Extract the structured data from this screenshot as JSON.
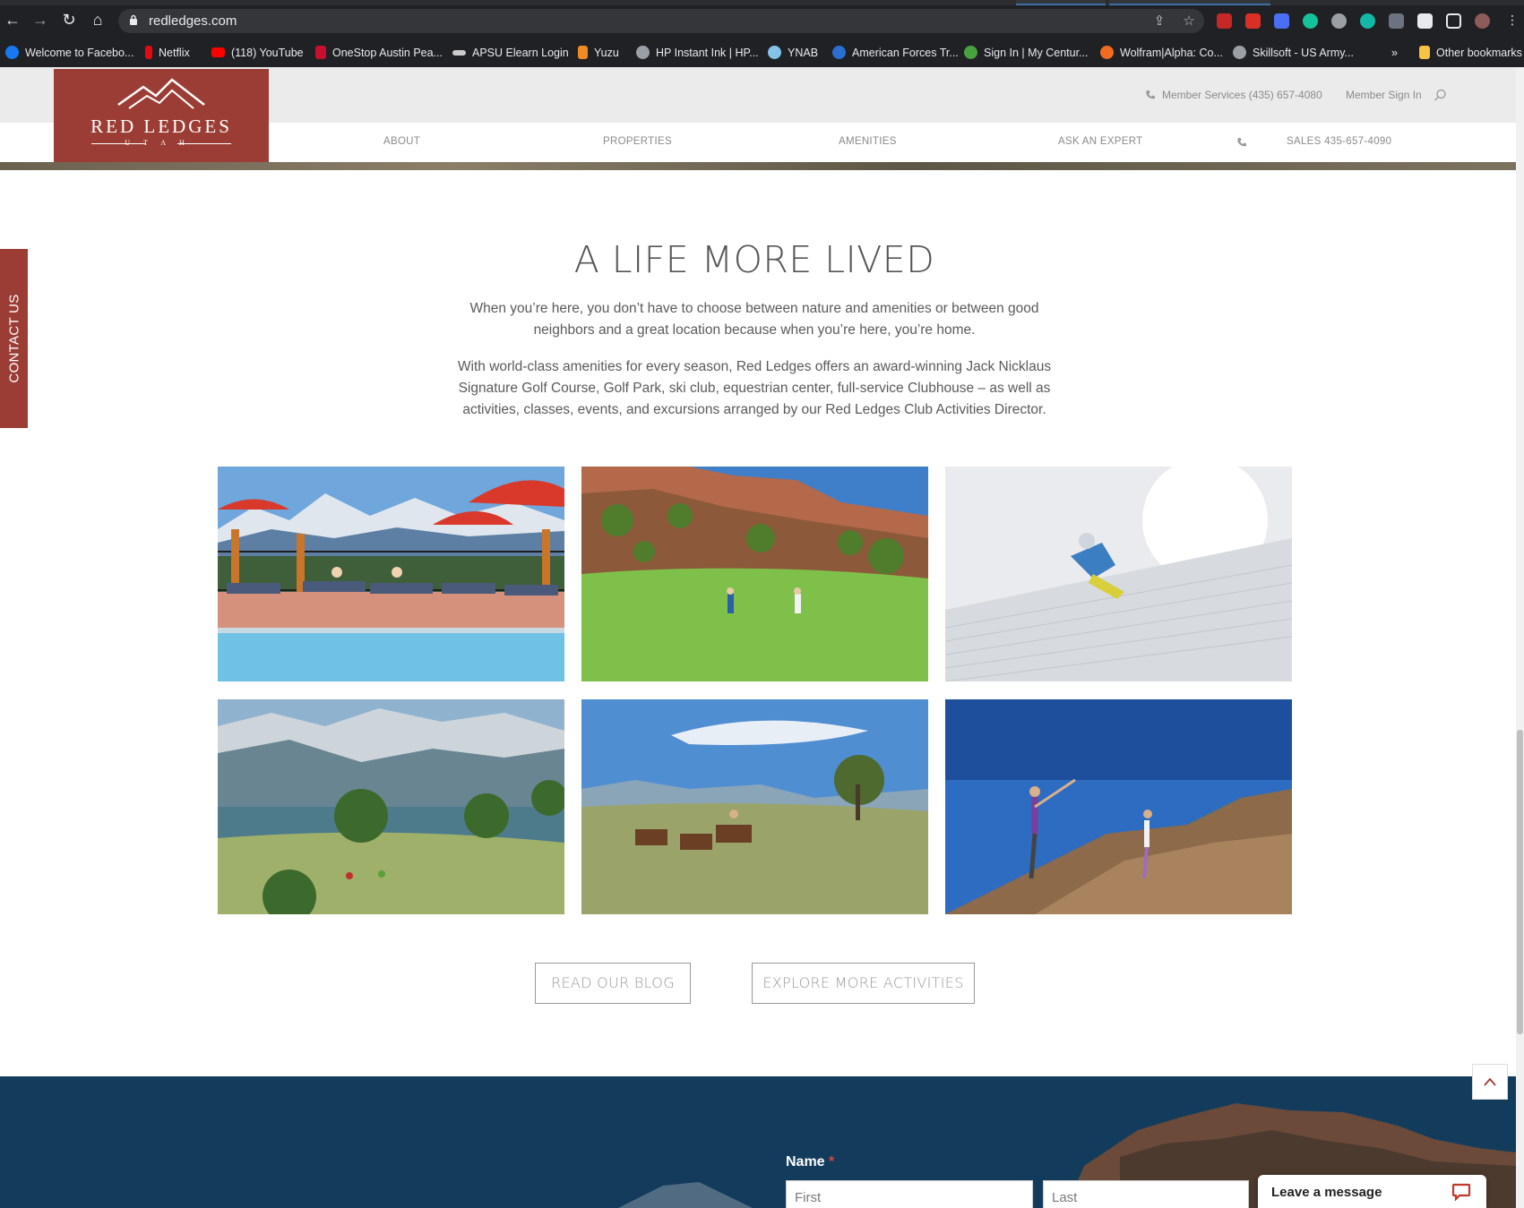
{
  "browser": {
    "url": "redledges.com",
    "bookmarks": [
      {
        "label": "Welcome to Facebo...",
        "color": "#1877f2"
      },
      {
        "label": "Netflix",
        "color": "#e50914"
      },
      {
        "label": "(118) YouTube",
        "color": "#ff0000"
      },
      {
        "label": "OneStop Austin Pea...",
        "color": "#c8102e"
      },
      {
        "label": "APSU Elearn Login",
        "color": "#cccccc"
      },
      {
        "label": "Yuzu",
        "color": "#f08a24"
      },
      {
        "label": "HP Instant Ink | HP...",
        "color": "#9aa0a6"
      },
      {
        "label": "YNAB",
        "color": "#85c3e9"
      },
      {
        "label": "American Forces Tr...",
        "color": "#2a6fd0"
      },
      {
        "label": "Sign In | My Centur...",
        "color": "#48a23f"
      },
      {
        "label": "Wolfram|Alpha: Co...",
        "color": "#f26b21"
      },
      {
        "label": "Skillsoft - US Army...",
        "color": "#9aa0a6"
      },
      {
        "label": "Other bookmarks",
        "color": "#f6c343"
      }
    ],
    "more_bookmarks": "»"
  },
  "header": {
    "logo_name": "RED LEDGES",
    "logo_sub": "UTAH",
    "member_services": "Member Services (435) 657-4080",
    "member_sign_in": "Member Sign In",
    "nav": {
      "about": "ABOUT",
      "properties": "PROPERTIES",
      "amenities": "AMENITIES",
      "ask_expert": "ASK AN EXPERT",
      "sales": "SALES 435-657-4090"
    },
    "contact_tab": "CONTACT US"
  },
  "content": {
    "headline": "A LIFE MORE LIVED",
    "paragraph1": "When you’re here, you don’t have to choose between nature and amenities or between good neighbors and a great location because when you’re here, you’re home.",
    "paragraph2": "With world-class amenities for every season, Red Ledges offers an award-winning Jack Nicklaus Signature Golf Course, Golf Park, ski club, equestrian center, full-service Clubhouse – as well as activities, classes, events, and excursions arranged by our Red Ledges Club Activities Director.",
    "photos": [
      "pool-photo",
      "golf-photo",
      "ski-photo",
      "biking-photo",
      "horseback-photo",
      "yoga-photo"
    ],
    "read_blog": "READ OUR BLOG",
    "explore": "EXPLORE MORE ACTIVITIES"
  },
  "form": {
    "name_label": "Name",
    "required_mark": "*",
    "first_placeholder": "First",
    "last_placeholder": "Last"
  },
  "chat": {
    "label": "Leave a message"
  },
  "colors": {
    "brand": "#9b3d35",
    "footer": "#133c5c"
  }
}
